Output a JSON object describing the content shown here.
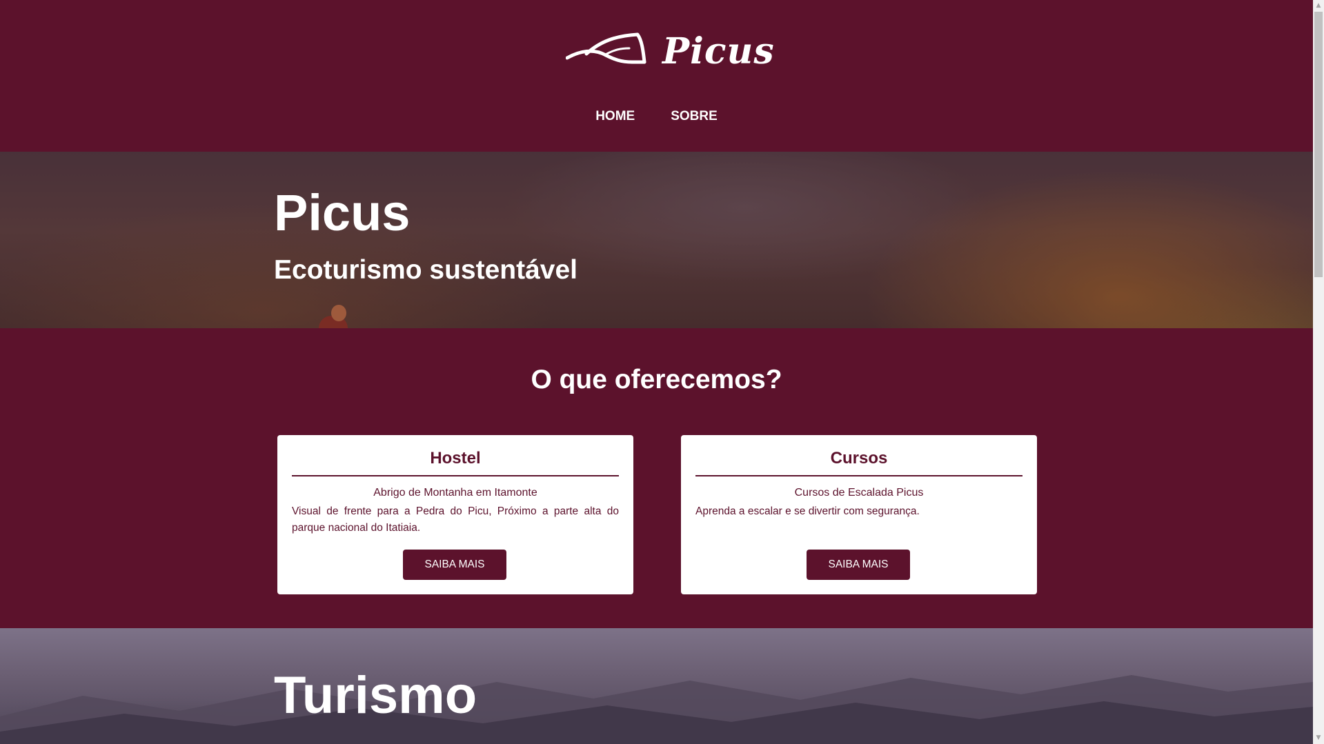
{
  "header": {
    "logo_text": "Picus",
    "nav": [
      {
        "label": "HOME"
      },
      {
        "label": "SOBRE"
      }
    ]
  },
  "hero": {
    "title": "Picus",
    "subtitle": "Ecoturismo sustentável"
  },
  "offers": {
    "title": "O que oferecemos?",
    "cards": [
      {
        "title": "Hostel",
        "subtitle": "Abrigo de Montanha em Itamonte",
        "text": "Visual de frente para a Pedra do Picu, Próximo a parte alta do parque nacional do Itatiaia.",
        "button": "SAIBA MAIS"
      },
      {
        "title": "Cursos",
        "subtitle": "Cursos de Escalada Picus",
        "text": "Aprenda a escalar e se divertir com segurança.",
        "button": "SAIBA MAIS"
      }
    ]
  },
  "tourism": {
    "title": "Turismo"
  },
  "colors": {
    "brand": "#5c122c",
    "card_bg": "#ffffff",
    "text_on_brand": "#ffffff"
  },
  "icons": {
    "logo": "mountain-logo-icon",
    "scroll_up": "scroll-up-arrow-icon",
    "scroll_down": "scroll-down-arrow-icon"
  }
}
